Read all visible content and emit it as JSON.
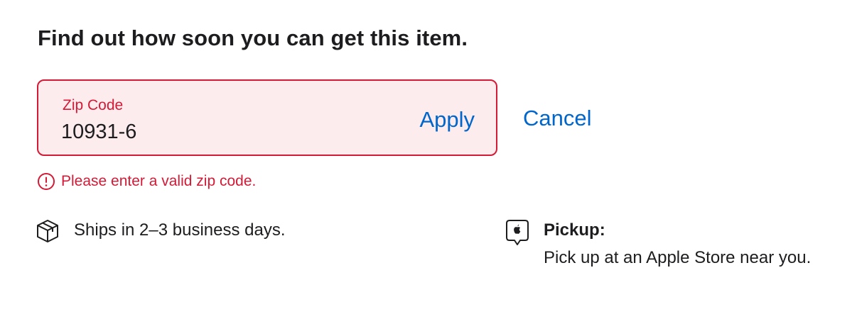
{
  "headline": "Find out how soon you can get this item.",
  "zip": {
    "label": "Zip Code",
    "value": "10931-6",
    "apply_label": "Apply",
    "error_message": "Please enter a valid zip code."
  },
  "cancel_label": "Cancel",
  "shipping": {
    "icon": "box-icon",
    "text": "Ships in 2–3 business days."
  },
  "pickup": {
    "icon": "apple-store-icon",
    "title": "Pickup:",
    "description": "Pick up at an Apple Store near you."
  },
  "colors": {
    "error": "#d31a36",
    "error_background": "#fcecee",
    "link": "#0066cc",
    "text": "#1d1d1f"
  }
}
